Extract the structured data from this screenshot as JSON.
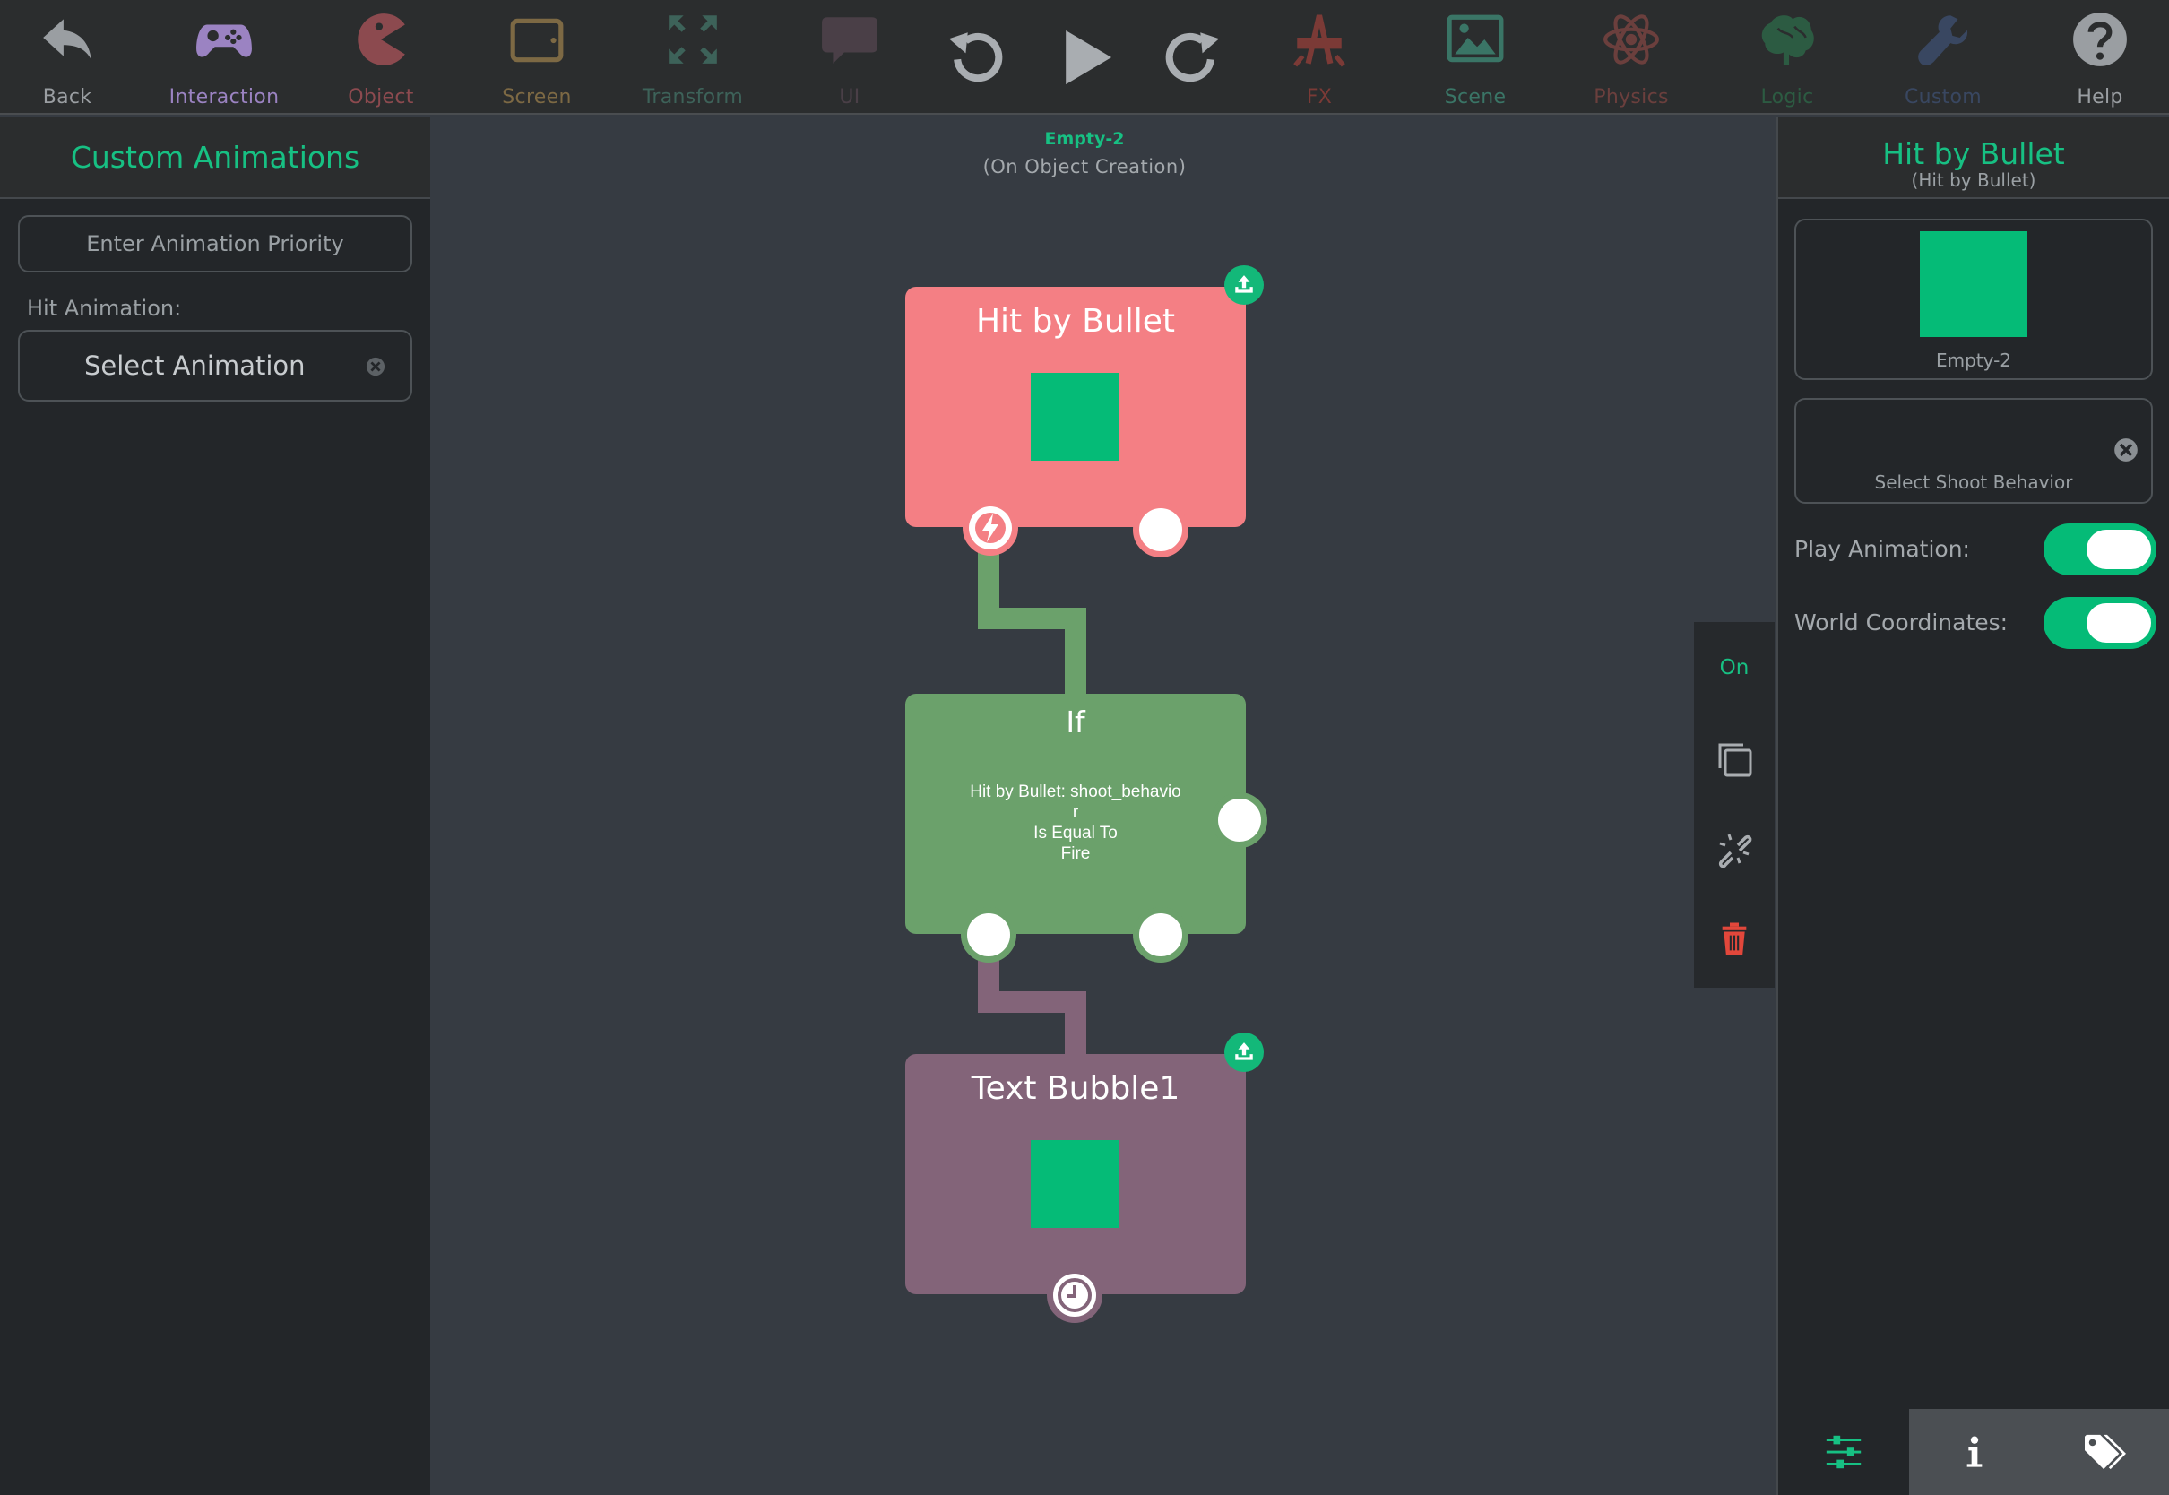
{
  "toolbar": {
    "items": [
      {
        "label": "Back",
        "icon": "back-arrow-icon",
        "color": "#9a9ea2"
      },
      {
        "label": "Interaction",
        "icon": "gamepad-icon",
        "color": "#9b83c2"
      },
      {
        "label": "Object",
        "icon": "pacman-icon",
        "color": "#8c4a4f"
      },
      {
        "label": "Screen",
        "icon": "tablet-icon",
        "color": "#7d6944"
      },
      {
        "label": "Transform",
        "icon": "expand-arrows-icon",
        "color": "#3d6259"
      },
      {
        "label": "UI",
        "icon": "speech-bubble-icon",
        "color": "#4a3f47"
      },
      {
        "label": "FX",
        "icon": "fx-icon",
        "color": "#7b3a36"
      },
      {
        "label": "Scene",
        "icon": "landscape-image-icon",
        "color": "#3a7566"
      },
      {
        "label": "Physics",
        "icon": "atom-icon",
        "color": "#6b3f3d"
      },
      {
        "label": "Logic",
        "icon": "brain-icon",
        "color": "#2c5b42"
      },
      {
        "label": "Custom",
        "icon": "wrench-icon",
        "color": "#394761"
      },
      {
        "label": "Help",
        "icon": "help-circle-icon",
        "color": "#9a9ea2"
      }
    ],
    "controls": {
      "undo": "undo-icon",
      "play": "play-icon",
      "redo": "redo-icon"
    }
  },
  "left_panel": {
    "title": "Custom Animations",
    "priority_placeholder": "Enter Animation Priority",
    "hit_animation_label": "Hit Animation:",
    "select_animation": "Select Animation"
  },
  "canvas": {
    "object_name": "Empty-2",
    "trigger": "(On Object Creation)",
    "nodes": {
      "hit": {
        "title": "Hit by Bullet",
        "color": "#f47f84"
      },
      "if": {
        "title": "If",
        "condition_lines": [
          "Hit by Bullet: shoot_behavio",
          "r",
          "Is Equal To",
          "Fire"
        ],
        "color": "#6ba16b"
      },
      "text": {
        "title": "Text Bubble1",
        "color": "#836479"
      }
    },
    "actions": {
      "on_label": "On"
    }
  },
  "right_panel": {
    "title": "Hit by Bullet",
    "subtitle": "(Hit by Bullet)",
    "object_name": "Empty-2",
    "shoot_behavior": "Select Shoot Behavior",
    "play_animation_label": "Play Animation:",
    "play_animation_on": true,
    "world_coordinates_label": "World Coordinates:",
    "world_coordinates_on": true,
    "tabs": [
      "sliders-icon",
      "info-icon",
      "tags-icon"
    ]
  },
  "colors": {
    "accent": "#17c083",
    "thumb": "#05bb77",
    "delete": "#e2473b"
  }
}
